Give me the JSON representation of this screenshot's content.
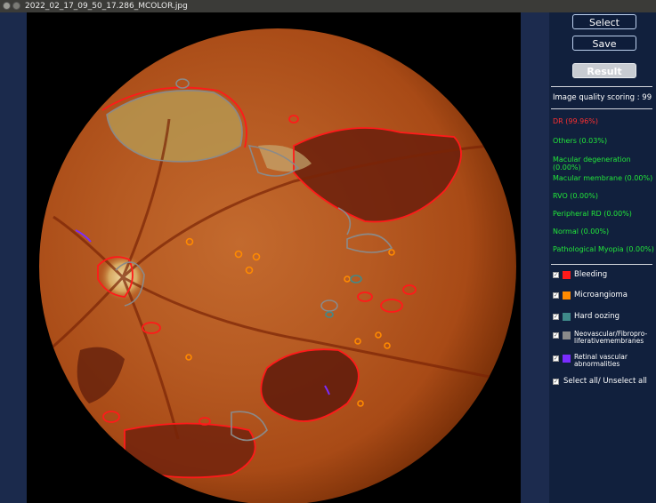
{
  "window": {
    "title": "2022_02_17_09_50_17.286_MCOLOR.jpg"
  },
  "buttons": {
    "select": "Select",
    "save": "Save",
    "result": "Result"
  },
  "quality": {
    "label": "Image quality scoring : 99"
  },
  "diagnoses": [
    {
      "label": "DR (99.96%)",
      "color": "#ff3030"
    },
    {
      "label": "Others (0.03%)",
      "color": "#22e63a"
    },
    {
      "label": "Macular degeneration (0.00%)",
      "color": "#22e63a"
    },
    {
      "label": "Macular membrane (0.00%)",
      "color": "#22e63a"
    },
    {
      "label": "RVO (0.00%)",
      "color": "#22e63a"
    },
    {
      "label": "Peripheral RD (0.00%)",
      "color": "#22e63a"
    },
    {
      "label": "Normal (0.00%)",
      "color": "#22e63a"
    },
    {
      "label": "Pathological Myopia (0.00%)",
      "color": "#22e63a"
    }
  ],
  "legend": [
    {
      "label": "Bleeding",
      "color": "#ff1a1a",
      "checked": true
    },
    {
      "label": "Microangioma",
      "color": "#ff8a00",
      "checked": true
    },
    {
      "label": "Hard oozing",
      "color": "#3f8a8a",
      "checked": true
    },
    {
      "label": "Neovascular/Fibropro-liferativemembranes",
      "color": "#8a8a8a",
      "checked": true
    },
    {
      "label": "Retinal vascular abnormalities",
      "color": "#7a2cff",
      "checked": true
    }
  ],
  "select_all": {
    "label": "Select all/ Unselect all",
    "checked": true
  },
  "icons": {
    "close": "close-icon",
    "minimize": "minimize-icon",
    "check": "checkmark-icon"
  }
}
